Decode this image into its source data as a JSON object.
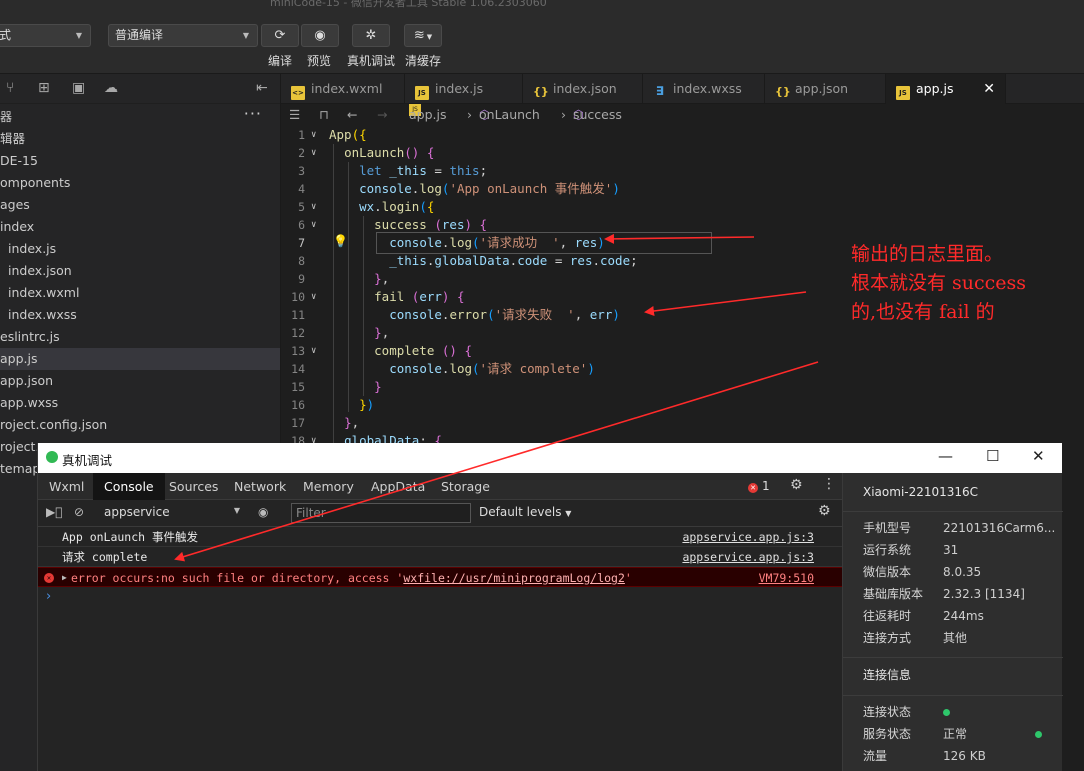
{
  "toolbar": {
    "window_title": "miniCode-15 - 微信开发者工具 Stable 1.06.2303060",
    "mode_select": "式",
    "compile_select": "普通编译",
    "buttons": [
      {
        "icon": "refresh-icon",
        "label": "编译"
      },
      {
        "icon": "eye-icon",
        "label": "预览"
      },
      {
        "icon": "bug-icon",
        "label": "真机调试"
      },
      {
        "icon": "layers-icon",
        "label": "清缓存"
      }
    ]
  },
  "sidebar": {
    "header": "器",
    "more": "···",
    "items": [
      {
        "label": "辑器",
        "indent": 0
      },
      {
        "label": "DE-15",
        "indent": 0
      },
      {
        "label": "omponents",
        "indent": 0
      },
      {
        "label": "ages",
        "indent": 0
      },
      {
        "label": "index",
        "indent": 0
      },
      {
        "label": "index.js",
        "indent": 1
      },
      {
        "label": "index.json",
        "indent": 1
      },
      {
        "label": "index.wxml",
        "indent": 1
      },
      {
        "label": "index.wxss",
        "indent": 1
      },
      {
        "label": "eslintrc.js",
        "indent": 0
      },
      {
        "label": "app.js",
        "indent": 0,
        "active": true
      },
      {
        "label": "app.json",
        "indent": 0
      },
      {
        "label": "app.wxss",
        "indent": 0
      },
      {
        "label": "roject.config.json",
        "indent": 0
      },
      {
        "label": "roject.",
        "indent": 0
      },
      {
        "label": "temap",
        "indent": 0
      }
    ]
  },
  "tabs": [
    {
      "label": "index.wxml",
      "type": "wxml"
    },
    {
      "label": "index.js",
      "type": "js"
    },
    {
      "label": "index.json",
      "type": "json"
    },
    {
      "label": "index.wxss",
      "type": "wxss"
    },
    {
      "label": "app.json",
      "type": "json"
    },
    {
      "label": "app.js",
      "type": "js",
      "active": true
    }
  ],
  "breadcrumb": {
    "file": "app.js",
    "method": "onLaunch",
    "callback": "success"
  },
  "code_lines": [
    "1",
    "2",
    "3",
    "4",
    "5",
    "6",
    "7",
    "8",
    "9",
    "10",
    "11",
    "12",
    "13",
    "14",
    "15",
    "16",
    "17",
    "18"
  ],
  "annotation": "输出的日志里面。\n根本就没有 success\n的,也没有 fail 的",
  "devtools": {
    "title": "真机调试",
    "tabs": [
      "Wxml",
      "Console",
      "Sources",
      "Network",
      "Memory",
      "AppData",
      "Storage"
    ],
    "active_tab": "Console",
    "error_count": "1",
    "context": "appservice",
    "filter_placeholder": "Filter",
    "levels": "Default levels",
    "logs": [
      {
        "msg": "App onLaunch 事件触发",
        "src": "appservice.app.js:3"
      },
      {
        "msg": "请求 complete",
        "src": "appservice.app.js:3"
      }
    ],
    "error": {
      "prefix": "error occurs:no such file or directory, access '",
      "link": "wxfile://usr/miniprogramLog/log2",
      "suffix": "'",
      "src": "VM79:510"
    },
    "prompt": "›",
    "device": {
      "name": "Xiaomi-22101316C",
      "rows": [
        {
          "k": "手机型号",
          "v": "22101316Carm6..."
        },
        {
          "k": "运行系统",
          "v": "31"
        },
        {
          "k": "微信版本",
          "v": "8.0.35"
        },
        {
          "k": "基础库版本",
          "v": "2.32.3 [1134]"
        },
        {
          "k": "往返耗时",
          "v": "244ms"
        },
        {
          "k": "连接方式",
          "v": "其他"
        }
      ],
      "conn_section": "连接信息",
      "conn_rows": [
        {
          "k": "连接状态",
          "v": ""
        },
        {
          "k": "服务状态",
          "v": "正常"
        },
        {
          "k": "流量",
          "v": "126 KB"
        }
      ]
    }
  },
  "colors": {
    "accent_red": "#ff2a2a",
    "status_green": "#2ec76b",
    "error_red": "#e53935"
  }
}
